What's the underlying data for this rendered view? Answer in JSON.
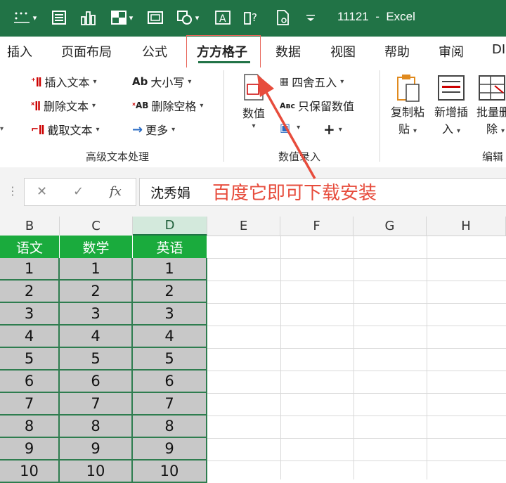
{
  "titlebar": {
    "filename": "11121",
    "separator": "-",
    "app": "Excel"
  },
  "tabs": [
    {
      "label": "插入",
      "active": false
    },
    {
      "label": "页面布局",
      "active": false
    },
    {
      "label": "公式",
      "active": false
    },
    {
      "label": "方方格子",
      "active": true
    },
    {
      "label": "数据",
      "active": false
    },
    {
      "label": "视图",
      "active": false
    },
    {
      "label": "帮助",
      "active": false
    },
    {
      "label": "审阅",
      "active": false
    },
    {
      "label": "DI",
      "active": false
    }
  ],
  "ribbon": {
    "text_group": {
      "insert_text": "插入文本",
      "delete_text": "删除文本",
      "extract_text": "截取文本",
      "case": "大小写",
      "delete_spaces": "删除空格",
      "more": "更多",
      "label": "高级文本处理"
    },
    "number_group": {
      "value": "数值",
      "round": "四舍五入",
      "keep_values": "只保留数值",
      "label": "数值录入"
    },
    "edit_group": {
      "copy_paste_1": "复制粘",
      "copy_paste_2": "贴",
      "add_insert_1": "新增插",
      "add_insert_2": "入",
      "batch_1": "批量删",
      "batch_2": "除",
      "label": "编辑"
    }
  },
  "formula_bar": {
    "cancel": "✕",
    "confirm": "✓",
    "fx": "fx",
    "value": "沈秀娟",
    "annotation": "百度它即可下载安装"
  },
  "columns": [
    "B",
    "C",
    "D",
    "E",
    "F",
    "G",
    "H"
  ],
  "table": {
    "headers": [
      "语文",
      "数学",
      "英语"
    ],
    "rows": [
      [
        "1",
        "1",
        "1"
      ],
      [
        "2",
        "2",
        "2"
      ],
      [
        "3",
        "3",
        "3"
      ],
      [
        "4",
        "4",
        "4"
      ],
      [
        "5",
        "5",
        "5"
      ],
      [
        "6",
        "6",
        "6"
      ],
      [
        "7",
        "7",
        "7"
      ],
      [
        "8",
        "8",
        "8"
      ],
      [
        "9",
        "9",
        "9"
      ],
      [
        "10",
        "10",
        "10"
      ]
    ]
  },
  "colors": {
    "excel_green": "#217346",
    "header_green": "#1aab3d",
    "annotation_red": "#e74c3c"
  }
}
